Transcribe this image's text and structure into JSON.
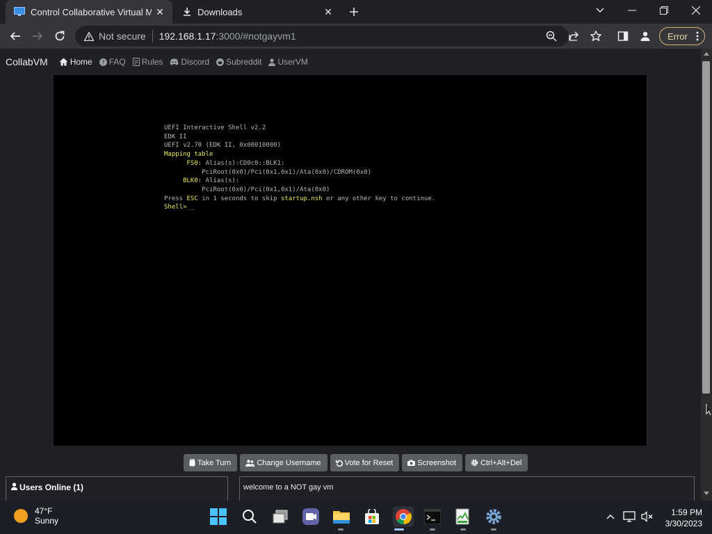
{
  "browser": {
    "tabs": [
      {
        "title": "Control Collaborative Virtual Mac",
        "active": true
      },
      {
        "title": "Downloads",
        "active": false
      }
    ],
    "security_label": "Not secure",
    "url_host": "192.168.1.17",
    "url_rest": ":3000/#notgayvm1",
    "error_label": "Error"
  },
  "site": {
    "brand": "CollabVM",
    "nav": [
      "Home",
      "FAQ",
      "Rules",
      "Discord",
      "Subreddit",
      "UserVM"
    ]
  },
  "console": {
    "lines": [
      "UEFI Interactive Shell v2.2",
      "EDK II",
      "UEFI v2.70 (EDK II, 0x00010000)"
    ],
    "mapping": "Mapping table",
    "fs0_label": "FS0:",
    "fs0_alias": " Alias(s):CD0c0::BLK1:",
    "fs0_path": "PciRoot(0x0)/Pci(0x1,0x1)/Ata(0x0)/CDROM(0x0)",
    "blk0_label": "BLK0:",
    "blk0_alias": " Alias(s):",
    "blk0_path": "PciRoot(0x0)/Pci(0x1,0x1)/Ata(0x0)",
    "press_prefix": "Press ",
    "press_esc": "ESC",
    "press_mid": " in 1 seconds to skip ",
    "press_file": "startup.nsh",
    "press_suffix": " or any other key to continue.",
    "prompt": "Shell>",
    "cursor": " _"
  },
  "vm_buttons": [
    "Take Turn",
    "Change Username",
    "Vote for Reset",
    "Screenshot",
    "Ctrl+Alt+Del"
  ],
  "users_online": "Users Online (1)",
  "chat_message": "welcome to a NOT gay vm",
  "taskbar": {
    "temp": "47°F",
    "condition": "Sunny",
    "time": "1:59 PM",
    "date": "3/30/2023"
  }
}
